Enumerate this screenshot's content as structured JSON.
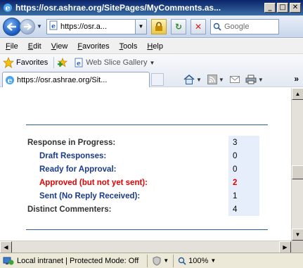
{
  "window": {
    "title": "https://osr.ashrae.org/SitePages/MyComments.as...",
    "minimize": "_",
    "maximize": "□",
    "close": "✕"
  },
  "nav": {
    "address": "https://osr.a...",
    "search_placeholder": "Google",
    "refresh_symbol": "↻",
    "stop_symbol": "✕"
  },
  "menu": {
    "items": [
      {
        "label": "File"
      },
      {
        "label": "Edit"
      },
      {
        "label": "View"
      },
      {
        "label": "Favorites"
      },
      {
        "label": "Tools"
      },
      {
        "label": "Help"
      }
    ]
  },
  "favorites": {
    "label": "Favorites",
    "web_slice": "Web Slice Gallery",
    "tab_label": "https://osr.ashrae.org/Sit...",
    "more": "»"
  },
  "stats": {
    "rows": [
      {
        "label": "Response in Progress:",
        "value": "3",
        "style": "top"
      },
      {
        "label": "Draft Responses:",
        "value": "0",
        "style": "sub"
      },
      {
        "label": "Ready for Approval:",
        "value": "0",
        "style": "sub"
      },
      {
        "label": "Approved (but not yet sent):",
        "value": "2",
        "style": "red"
      },
      {
        "label": "Sent (No Reply Received):",
        "value": "1",
        "style": "sub"
      },
      {
        "label": "Distinct Commenters:",
        "value": "4",
        "style": "top"
      }
    ]
  },
  "status": {
    "zone": "Local intranet | Protected Mode: Off",
    "zoom": "100%"
  },
  "colors": {
    "accent": "#2f5d9a",
    "warning": "#e60000",
    "value_bg": "#e6eefb"
  }
}
